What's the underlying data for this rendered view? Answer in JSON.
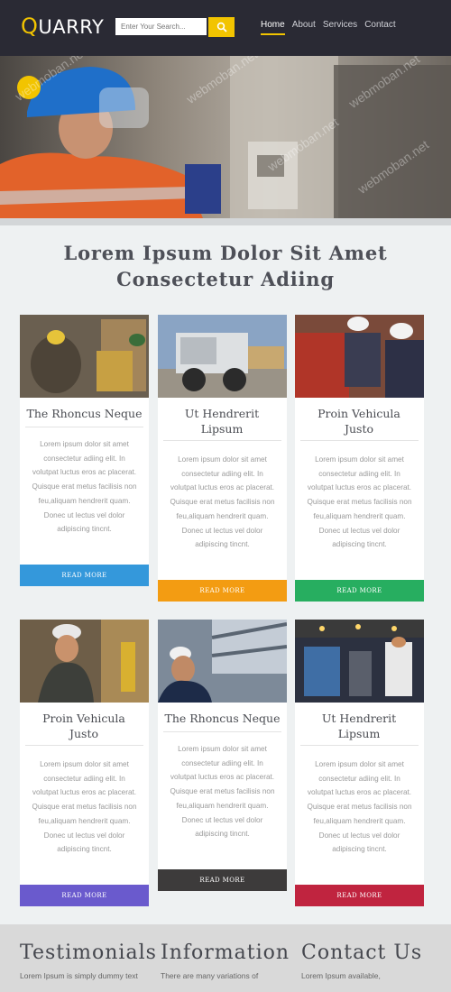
{
  "header": {
    "logo_first": "Q",
    "logo_rest": "UARRY",
    "search_placeholder": "Enter Your Search...",
    "nav": [
      "Home",
      "About",
      "Services",
      "Contact"
    ]
  },
  "watermark": "webmoban.net",
  "section": {
    "title_line1": "Lorem Ipsum Dolor Sit Amet",
    "title_line2": "Consectetur Adiing"
  },
  "cards": [
    {
      "title": "The Rhoncus Neque",
      "button": "READ MORE",
      "button_color": "#3498db"
    },
    {
      "title": "Ut Hendrerit Lipsum",
      "button": "READ MORE",
      "button_color": "#f39c12"
    },
    {
      "title": "Proin Vehicula Justo",
      "button": "READ MORE",
      "button_color": "#27ae60"
    },
    {
      "title": "Proin Vehicula Justo",
      "button": "READ MORE",
      "button_color": "#6a5acd"
    },
    {
      "title": "The Rhoncus Neque",
      "button": "READ MORE",
      "button_color": "#3d3b3b"
    },
    {
      "title": "Ut Hendrerit Lipsum",
      "button": "READ MORE",
      "button_color": "#c0243f"
    }
  ],
  "card_text": "Lorem ipsum dolor sit amet consectetur adiing elit. In volutpat luctus eros ac placerat. Quisque erat metus facilisis non feu,aliquam hendrerit quam. Donec ut lectus vel dolor adipiscing tincnt.",
  "footer": {
    "columns": [
      {
        "title": "Testimonials",
        "text": "Lorem Ipsum is simply dummy text"
      },
      {
        "title": "Information",
        "text": "There are many variations of"
      },
      {
        "title": "Contact Us",
        "text": "Lorem Ipsum available,"
      }
    ]
  },
  "colors": {
    "accent": "#f2c400",
    "header_bg": "#2a2a34",
    "page_bg": "#eef1f2"
  }
}
